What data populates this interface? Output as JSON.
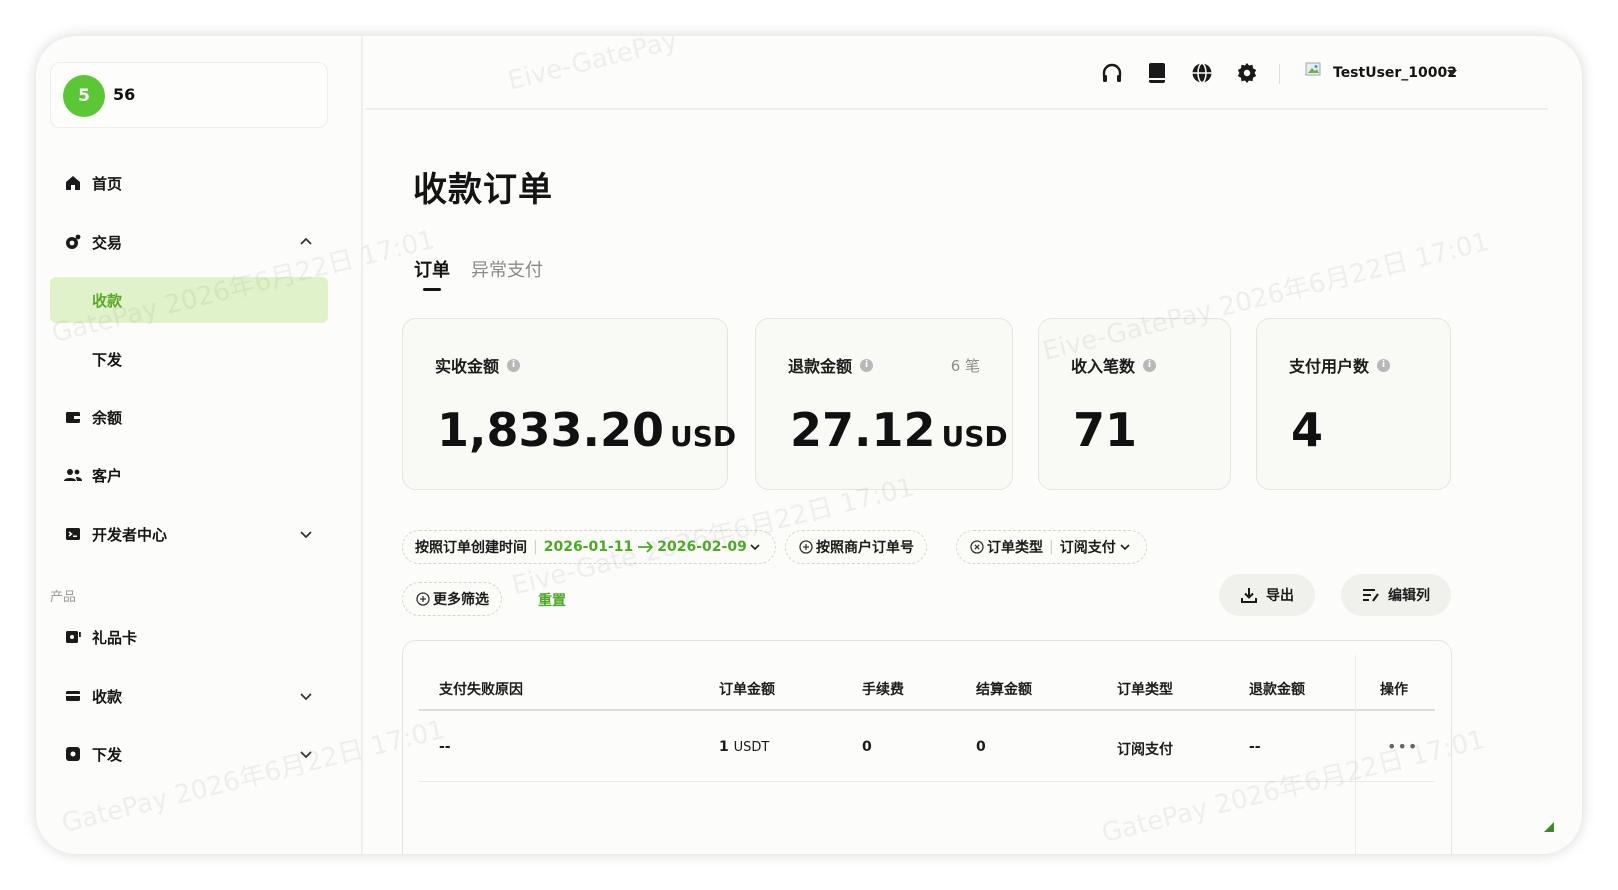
{
  "brand": {
    "badge": "5",
    "name": "56"
  },
  "sidebar": {
    "items": [
      {
        "label": "首页"
      },
      {
        "label": "交易"
      },
      {
        "label": "收款"
      },
      {
        "label": "下发"
      },
      {
        "label": "余额"
      },
      {
        "label": "客户"
      },
      {
        "label": "开发者中心"
      }
    ],
    "section_label": "产品",
    "product_items": [
      {
        "label": "礼品卡"
      },
      {
        "label": "收款"
      },
      {
        "label": "下发"
      }
    ]
  },
  "header": {
    "username": "TestUser_10002"
  },
  "page": {
    "title": "收款订单"
  },
  "tabs": [
    {
      "label": "订单"
    },
    {
      "label": "异常支付"
    }
  ],
  "stats": [
    {
      "label": "实收金额",
      "value": "1,833.20",
      "unit": "USD"
    },
    {
      "label": "退款金额",
      "value": "27.12",
      "unit": "USD",
      "count": "6 笔"
    },
    {
      "label": "收入笔数",
      "value": "71"
    },
    {
      "label": "支付用户数",
      "value": "4"
    }
  ],
  "filters": {
    "date_label": "按照订单创建时间",
    "date_start": "2026-01-11",
    "date_end": "2026-02-09",
    "merchant_order": "按照商户订单号",
    "order_type_label": "订单类型",
    "order_type_value": "订阅支付",
    "more_filters": "更多筛选",
    "reset": "重置"
  },
  "actions": {
    "export": "导出",
    "edit_columns": "编辑列"
  },
  "table": {
    "headers": [
      "支付失败原因",
      "订单金额",
      "手续费",
      "结算金额",
      "订单类型",
      "退款金额",
      "操作"
    ],
    "rows": [
      {
        "fail_reason": "--",
        "amount_num": "1",
        "amount_unit": "USDT",
        "fee": "0",
        "settled": "0",
        "type": "订阅支付",
        "refund": "--",
        "more": "•••"
      }
    ]
  },
  "colors": {
    "accent": "#5cc736",
    "active_bg": "#dff2c9",
    "accent_text": "#4fa72a"
  }
}
